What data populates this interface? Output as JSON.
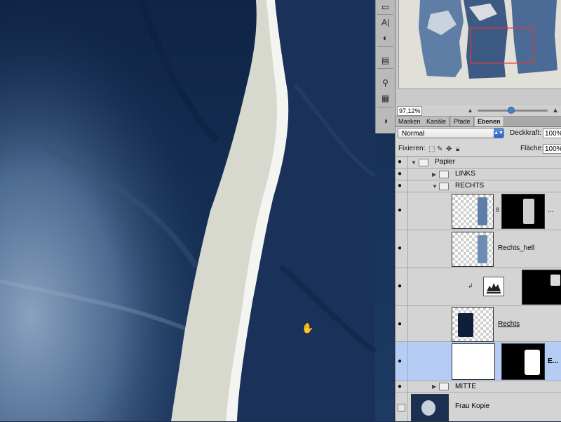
{
  "navigator": {
    "zoom": "97,12%"
  },
  "tabs": [
    "Masken",
    "Kanäle",
    "Pfade",
    "Ebenen"
  ],
  "layer_options": {
    "blend_mode": "Normal",
    "opacity_label": "Deckkraft:",
    "opacity_value": "100%",
    "lock_label": "Fixieren:",
    "fill_label": "Fläche:",
    "fill_value": "100%"
  },
  "layers": [
    {
      "name": "Papier"
    },
    {
      "name": "LINKS"
    },
    {
      "name": "RECHTS"
    },
    {
      "name": "..."
    },
    {
      "name": "Rechts_hell"
    },
    {
      "name": ""
    },
    {
      "name": "Rechts"
    },
    {
      "name": "E..."
    },
    {
      "name": "MITTE"
    },
    {
      "name": "Frau Kopie"
    }
  ],
  "colors": {
    "canvas_dark": "#12284a",
    "paper_gap": "#d7d9cf",
    "selection_highlight": "#b5cdf4",
    "blend_arrow": "#3a74d4",
    "nav_view_box": "#e23b3b"
  }
}
